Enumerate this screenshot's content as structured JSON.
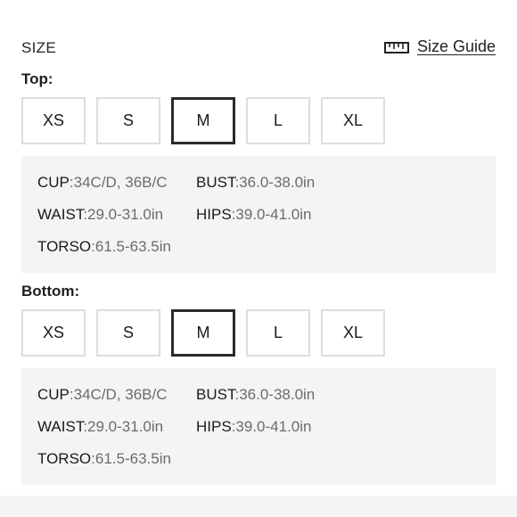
{
  "header": {
    "size_label": "SIZE",
    "size_guide_label": "Size Guide",
    "size_guide_icon": "ruler-icon"
  },
  "top": {
    "label": "Top:",
    "sizes": [
      "XS",
      "S",
      "M",
      "L",
      "XL"
    ],
    "selected": "M",
    "measurements": {
      "cup": {
        "key": "CUP",
        "value": ":34C/D, 36B/C"
      },
      "bust": {
        "key": "BUST",
        "value": ":36.0-38.0in"
      },
      "waist": {
        "key": "WAIST",
        "value": ":29.0-31.0in"
      },
      "hips": {
        "key": "HIPS",
        "value": ":39.0-41.0in"
      },
      "torso": {
        "key": "TORSO",
        "value": ":61.5-63.5in"
      }
    }
  },
  "bottom": {
    "label": "Bottom:",
    "sizes": [
      "XS",
      "S",
      "M",
      "L",
      "XL"
    ],
    "selected": "M",
    "measurements": {
      "cup": {
        "key": "CUP",
        "value": ":34C/D, 36B/C"
      },
      "bust": {
        "key": "BUST",
        "value": ":36.0-38.0in"
      },
      "waist": {
        "key": "WAIST",
        "value": ":29.0-31.0in"
      },
      "hips": {
        "key": "HIPS",
        "value": ":39.0-41.0in"
      },
      "torso": {
        "key": "TORSO",
        "value": ":61.5-63.5in"
      }
    }
  },
  "colors": {
    "selected_border": "#2a2a2a",
    "unselected_border": "#dedede",
    "panel_background": "#f4f4f4",
    "value_text": "#6b6b6b"
  }
}
